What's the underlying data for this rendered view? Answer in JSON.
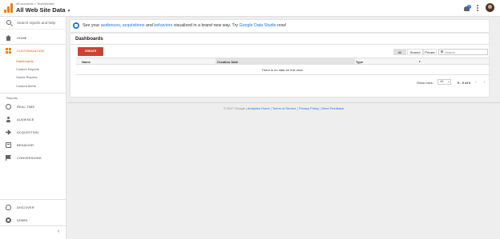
{
  "header": {
    "breadcrumb": "All accounts > TestWebsite",
    "account_view": "All Web Site Data",
    "notification_count": "1"
  },
  "sidebar": {
    "search_placeholder": "Search reports and help",
    "home": "HOME",
    "customization": "CUSTOMIZATION",
    "sub_items": [
      "Dashboards",
      "Custom Reports",
      "Saved Reports",
      "Custom Alerts"
    ],
    "reports_label": "Reports",
    "report_items": [
      "REAL-TIME",
      "AUDIENCE",
      "ACQUISITION",
      "BEHAVIOR",
      "CONVERSIONS"
    ],
    "discover": "DISCOVER",
    "admin": "ADMIN",
    "collapse": "‹"
  },
  "banner": {
    "prefix": "See your ",
    "link1": "audiences",
    "sep1": ", ",
    "link2": "acquisitions",
    "sep2": " and ",
    "link3": "behaviors",
    "middle": " visualized in a brand new way. Try ",
    "link4": "Google Data Studio",
    "suffix": " now!"
  },
  "dashboards": {
    "title": "Dashboards",
    "create_label": "CREATE",
    "filters": [
      "All",
      "Shared",
      "Private"
    ],
    "active_filter": "All",
    "search_placeholder": "Search",
    "columns": [
      "Name",
      "Creation Date",
      "Type"
    ],
    "empty_message": "There is no data for this view.",
    "show_rows_label": "Show rows:",
    "rows_value": "10",
    "range": "0 - 0 of 0",
    "prev": "‹",
    "next": "›"
  },
  "footer": {
    "copyright": "© 2017 Google | ",
    "links": [
      "Analytics Home",
      "Terms of Service",
      "Privacy Policy",
      "Send Feedback"
    ],
    "sep": " | "
  },
  "colors": {
    "accent": "#f57c00",
    "create_button": "#d23f31",
    "link": "#1a73e8"
  }
}
